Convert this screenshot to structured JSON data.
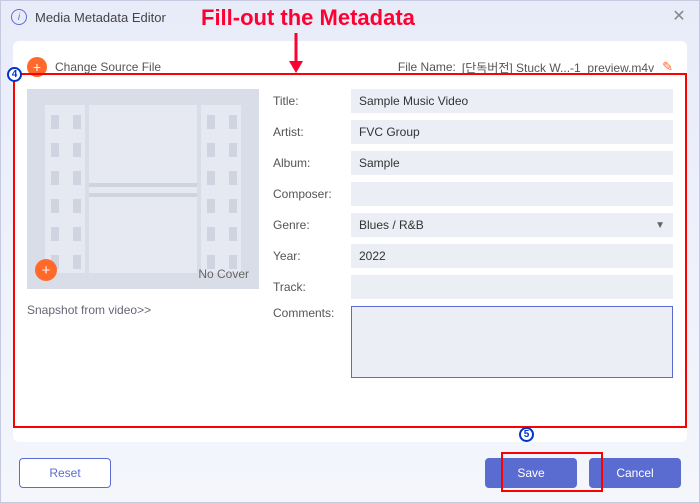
{
  "window": {
    "title": "Media Metadata Editor"
  },
  "annotation": {
    "headline": "Fill-out the Metadata",
    "step4": "4",
    "step5": "5"
  },
  "toprow": {
    "change_source": "Change Source File",
    "filename_label": "File Name:",
    "filename_value": "[단독버전] Stuck W...-1_preview.m4v"
  },
  "cover": {
    "no_cover": "No Cover",
    "snapshot": "Snapshot from video>>"
  },
  "fields": {
    "title": {
      "label": "Title:",
      "value": "Sample Music Video"
    },
    "artist": {
      "label": "Artist:",
      "value": "FVC Group"
    },
    "album": {
      "label": "Album:",
      "value": "Sample"
    },
    "composer": {
      "label": "Composer:",
      "value": ""
    },
    "genre": {
      "label": "Genre:",
      "value": "Blues / R&B"
    },
    "year": {
      "label": "Year:",
      "value": "2022"
    },
    "track": {
      "label": "Track:",
      "value": ""
    },
    "comments": {
      "label": "Comments:",
      "value": ""
    }
  },
  "footer": {
    "reset": "Reset",
    "save": "Save",
    "cancel": "Cancel"
  }
}
